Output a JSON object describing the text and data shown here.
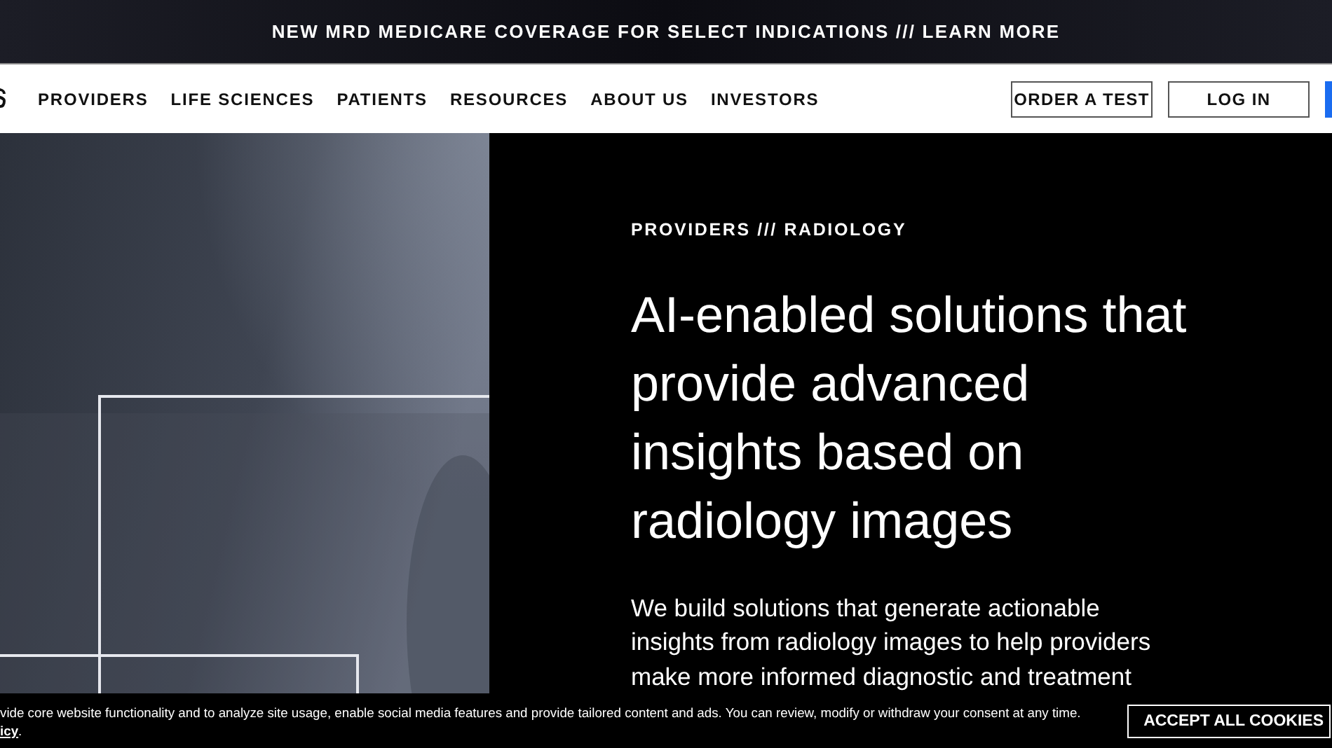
{
  "announcement": {
    "text": "NEW MRD MEDICARE COVERAGE FOR SELECT INDICATIONS /// LEARN MORE"
  },
  "nav": {
    "links": [
      "PROVIDERS",
      "LIFE SCIENCES",
      "PATIENTS",
      "RESOURCES",
      "ABOUT US",
      "INVESTORS"
    ],
    "buttons": [
      {
        "label": "ORDER A TEST",
        "kind": "outline"
      },
      {
        "label": "LOG IN",
        "kind": "outline"
      },
      {
        "kind": "primary"
      }
    ]
  },
  "hero": {
    "breadcrumb": "PROVIDERS /// RADIOLOGY",
    "heading": "AI-enabled solutions that provide advanced insights based on radiology images",
    "description": "We build solutions that generate actionable insights from radiology images to help providers make more informed diagnostic and treatment"
  },
  "cookie_bar": {
    "text": "vide core website functionality and to analyze site usage, enable social media features and provide tailored content and ads. You can review, modify or withdraw your consent at any time.",
    "link": "icy",
    "link_suffix": ".",
    "button": "ACCEPT ALL COOKIES"
  }
}
